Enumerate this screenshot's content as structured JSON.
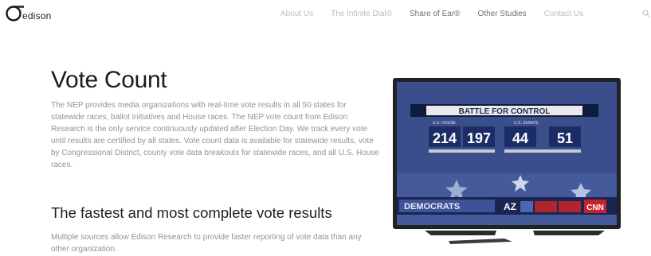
{
  "brand": {
    "logo_text": "edison"
  },
  "nav": [
    {
      "label": "About Us",
      "active": false
    },
    {
      "label": "The Infinite Dial®",
      "active": false
    },
    {
      "label": "Share of Ear®",
      "active": true
    },
    {
      "label": "Other Studies",
      "active": true
    },
    {
      "label": "Contact Us",
      "active": false
    }
  ],
  "main": {
    "title": "Vote Count",
    "paragraph": "The NEP provides media organizations with real-time vote results in all 50 states for statewide races, ballot initiatives and House races. The NEP vote count from Edison Research is the only service continuously updated after Election Day. We track every vote until results are certified by all states. Vote count data is available for statewide results, vote by Congressional District, county vote data breakouts for statewide races, and all U.S. House races.",
    "subheading": "The fastest and most complete vote results",
    "paragraph2": "Multiple sources allow Edison Research to provide faster reporting of vote data than any other organization."
  },
  "tv": {
    "banner": "BATTLE FOR CONTROL",
    "house_label": "U.S. HOUSE",
    "senate_label": "U.S. SENATE",
    "numbers": [
      "214",
      "197",
      "44",
      "51"
    ],
    "bottom_left": "DEMOCRATS",
    "state": "AZ",
    "network": "CNN"
  },
  "colors": {
    "accent": "#f28c28",
    "nav_muted": "#b9bec7",
    "body_text": "#8e939a",
    "title": "#1b1b1b",
    "tv_bg": "#3b4e8c",
    "tv_red": "#b0262f"
  }
}
